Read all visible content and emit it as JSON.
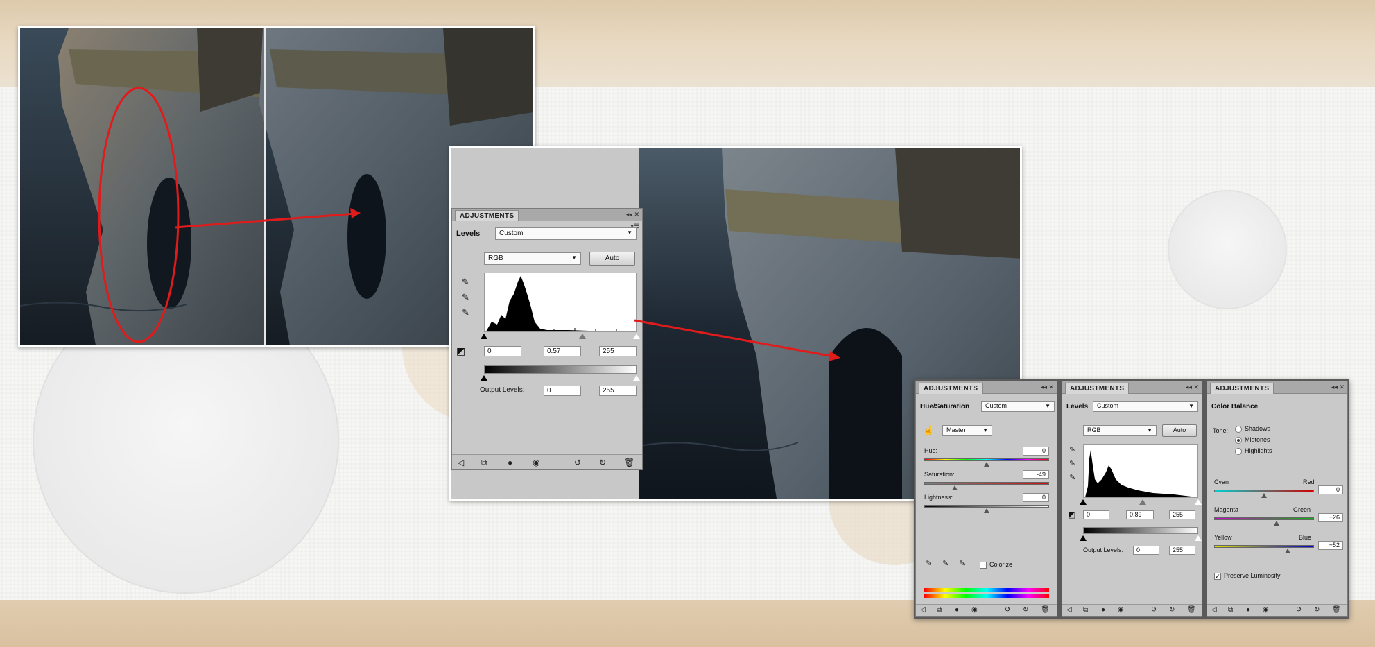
{
  "colors": {
    "annotation_red": "#e01b1b",
    "panel_bg": "#c9c9c9"
  },
  "levels_panel": {
    "tab": "ADJUSTMENTS",
    "type_label": "Levels",
    "preset": "Custom",
    "channel": "RGB",
    "auto_label": "Auto",
    "input_black": "0",
    "input_gamma": "0.57",
    "input_white": "255",
    "output_label": "Output Levels:",
    "output_black": "0",
    "output_white": "255"
  },
  "hue_sat_panel": {
    "tab": "ADJUSTMENTS",
    "type_label": "Hue/Saturation",
    "preset": "Custom",
    "range": "Master",
    "hue_label": "Hue:",
    "hue_value": "0",
    "saturation_label": "Saturation:",
    "saturation_value": "-49",
    "lightness_label": "Lightness:",
    "lightness_value": "0",
    "colorize_label": "Colorize"
  },
  "levels_panel_small": {
    "tab": "ADJUSTMENTS",
    "type_label": "Levels",
    "preset": "Custom",
    "channel": "RGB",
    "auto_label": "Auto",
    "input_black": "0",
    "input_gamma": "0.89",
    "input_white": "255",
    "output_label": "Output Levels:",
    "output_black": "0",
    "output_white": "255"
  },
  "color_balance_panel": {
    "tab": "ADJUSTMENTS",
    "type_label": "Color Balance",
    "tone_label": "Tone:",
    "tone_options": [
      "Shadows",
      "Midtones",
      "Highlights"
    ],
    "tone_selected": "Midtones",
    "cyan_label": "Cyan",
    "red_label": "Red",
    "cyan_red_value": "0",
    "magenta_label": "Magenta",
    "green_label": "Green",
    "magenta_green_value": "+26",
    "yellow_label": "Yellow",
    "blue_label": "Blue",
    "yellow_blue_value": "+52",
    "preserve_label": "Preserve Luminosity",
    "preserve_checked": true
  }
}
